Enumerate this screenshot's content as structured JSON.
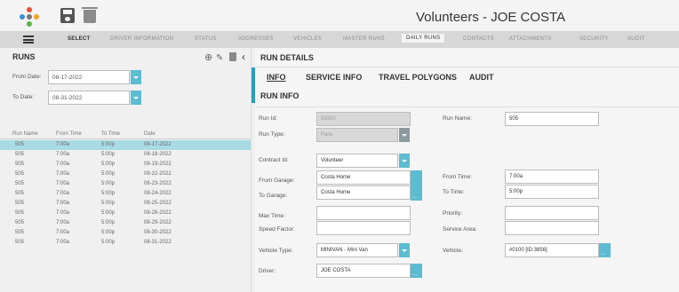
{
  "window": {
    "title": "Volunteers  - JOE COSTA"
  },
  "nav": {
    "select": "SELECT",
    "items": [
      "DRIVER INFORMATION",
      "STATUS",
      "ADDRESSES",
      "VEHICLES",
      "MASTER RUNS",
      "DAILY RUNS",
      "CONTACTS",
      "ATTACHMENTS",
      "SECURITY",
      "AUDIT"
    ],
    "active": "DAILY RUNS"
  },
  "runs_panel": {
    "title": "RUNS",
    "from_date_label": "From Date:",
    "from_date": "08-17-2022",
    "to_date_label": "To Date:",
    "to_date": "08-31-2022",
    "columns": [
      "Run Name",
      "From Time",
      "To Time",
      "Date"
    ],
    "rows": [
      [
        "505",
        "7:00a",
        "5:00p",
        "08-17-2022"
      ],
      [
        "505",
        "7:00a",
        "5:00p",
        "08-18-2022"
      ],
      [
        "505",
        "7:00a",
        "5:00p",
        "08-19-2022"
      ],
      [
        "505",
        "7:00a",
        "5:00p",
        "08-22-2022"
      ],
      [
        "505",
        "7:00a",
        "5:00p",
        "08-23-2022"
      ],
      [
        "505",
        "7:00a",
        "5:00p",
        "08-24-2022"
      ],
      [
        "505",
        "7:00a",
        "5:00p",
        "08-25-2022"
      ],
      [
        "505",
        "7:00a",
        "5:00p",
        "08-26-2022"
      ],
      [
        "505",
        "7:00a",
        "5:00p",
        "08-29-2022"
      ],
      [
        "505",
        "7:00a",
        "5:00p",
        "08-30-2022"
      ],
      [
        "505",
        "7:00a",
        "5:00p",
        "08-31-2022"
      ]
    ],
    "selected_row": 0
  },
  "run_details": {
    "title": "RUN DETAILS",
    "tabs": [
      "INFO",
      "SERVICE INFO",
      "TRAVEL POLYGONS",
      "AUDIT"
    ],
    "active_tab": "INFO",
    "section": "RUN INFO",
    "run_id_label": "Run Id:",
    "run_id": "59330",
    "run_name_label": "Run Name:",
    "run_name": "505",
    "run_type_label": "Run Type:",
    "run_type": "Para",
    "contract_id_label": "Contract Id:",
    "contract_id": "Volunteer",
    "from_garage_label": "From Garage:",
    "from_garage": "Costa Home",
    "to_garage_label": "To Garage:",
    "to_garage": "Costa Home",
    "from_time_label": "From Time:",
    "from_time": "7:00a",
    "to_time_label": "To Time:",
    "to_time": "5:00p",
    "max_time_label": "Max Time:",
    "max_time": "",
    "speed_factor_label": "Speed Factor:",
    "speed_factor": "",
    "priority_label": "Priority:",
    "priority": "",
    "service_area_label": "Service Area:",
    "service_area": "",
    "vehicle_type_label": "Vehicle Type:",
    "vehicle_type": "MINIVAN - Mini Van",
    "vehicle_label": "Vehicle:",
    "vehicle": "#0100 [ID:3856]",
    "driver_label": "Driver:",
    "driver": "JOE COSTA"
  },
  "colors": {
    "accent": "#5bbcd2",
    "selected_row": "#a9dbe4",
    "scroll": "#2b9dbd"
  }
}
